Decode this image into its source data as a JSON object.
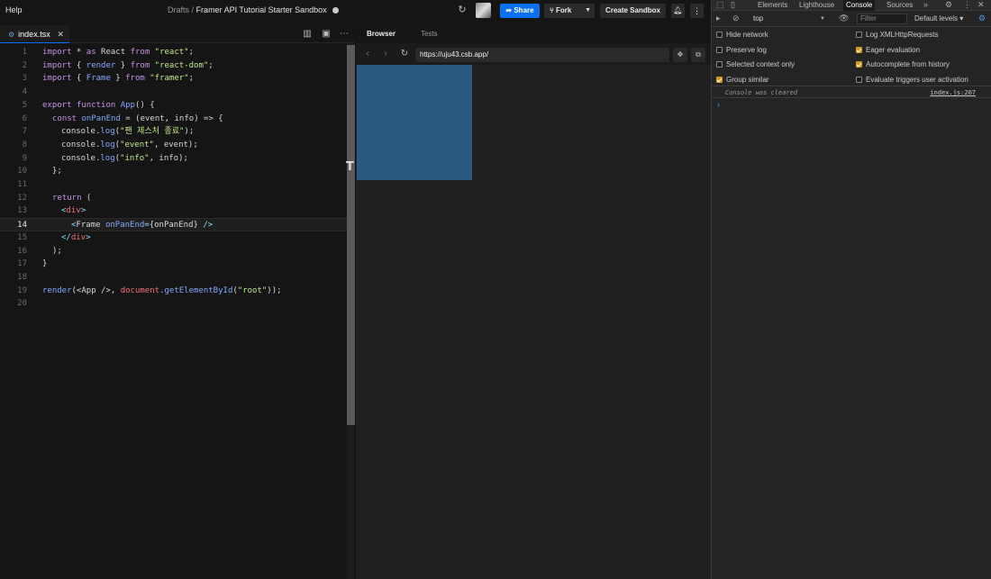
{
  "topbar": {
    "help": "Help",
    "crumb_parent": "Drafts",
    "crumb_sep": "/",
    "sandbox_title": "Framer API Tutorial Starter Sandbox",
    "share_label": "Share",
    "fork_label": "Fork",
    "create_label": "Create Sandbox"
  },
  "editor": {
    "tab_name": "index.tsx",
    "active_line": 14,
    "lines": [
      {
        "n": "1"
      },
      {
        "n": "2"
      },
      {
        "n": "3"
      },
      {
        "n": "4"
      },
      {
        "n": "5"
      },
      {
        "n": "6"
      },
      {
        "n": "7"
      },
      {
        "n": "8"
      },
      {
        "n": "9"
      },
      {
        "n": "10"
      },
      {
        "n": "11"
      },
      {
        "n": "12"
      },
      {
        "n": "13"
      },
      {
        "n": "14"
      },
      {
        "n": "15"
      },
      {
        "n": "16"
      },
      {
        "n": "17"
      },
      {
        "n": "18"
      },
      {
        "n": "19"
      },
      {
        "n": "20"
      }
    ],
    "code": {
      "l1": [
        "import",
        " * ",
        "as",
        " React ",
        "from",
        " ",
        "\"react\"",
        ";"
      ],
      "l2": [
        "import",
        " { ",
        "render",
        " } ",
        "from",
        " ",
        "\"react-dom\"",
        ";"
      ],
      "l3": [
        "import",
        " { ",
        "Frame",
        " } ",
        "from",
        " ",
        "\"framer\"",
        ";"
      ],
      "l5": [
        "export",
        " ",
        "function",
        " ",
        "App",
        "() {"
      ],
      "l6": [
        "const",
        " ",
        "onPanEnd",
        " = (",
        "event",
        ", ",
        "info",
        ") => {"
      ],
      "l7": [
        "console",
        ".",
        "log",
        "(",
        "\"팬 제스처 종료\"",
        ");"
      ],
      "l8": [
        "console",
        ".",
        "log",
        "(",
        "\"event\"",
        ", event);"
      ],
      "l9": [
        "console",
        ".",
        "log",
        "(",
        "\"info\"",
        ", info);"
      ],
      "l10": [
        "};"
      ],
      "l12": [
        "return",
        " ("
      ],
      "l13": [
        "<",
        "div",
        ">"
      ],
      "l14": [
        "<",
        "Frame",
        " ",
        "onPanEnd",
        "=",
        "{onPanEnd}",
        " />"
      ],
      "l15": [
        "</",
        "div",
        ">"
      ],
      "l16": [
        ");"
      ],
      "l17": [
        "}"
      ],
      "l19": [
        "render",
        "(<",
        "App",
        " />, ",
        "document",
        ".",
        "getElementById",
        "(",
        "\"root\"",
        "));"
      ]
    }
  },
  "browser": {
    "tab_browser": "Browser",
    "tab_tests": "Tests",
    "url": "https://uju43.csb.app/",
    "box_color": "#2a5a7d"
  },
  "devtools": {
    "tabs": [
      "Elements",
      "Lighthouse",
      "Console",
      "Sources"
    ],
    "active_tab": "Console",
    "context": "top",
    "filter_placeholder": "Filter",
    "levels": "Default levels",
    "options": [
      {
        "label": "Hide network",
        "checked": false
      },
      {
        "label": "Log XMLHttpRequests",
        "checked": false
      },
      {
        "label": "Preserve log",
        "checked": false
      },
      {
        "label": "Eager evaluation",
        "checked": true
      },
      {
        "label": "Selected context only",
        "checked": false
      },
      {
        "label": "Autocomplete from history",
        "checked": true
      },
      {
        "label": "Group similar",
        "checked": true
      },
      {
        "label": "Evaluate triggers user activation",
        "checked": false
      }
    ],
    "cleared_msg": "Console was cleared",
    "cleared_src": "index.js:207",
    "prompt": "›"
  }
}
